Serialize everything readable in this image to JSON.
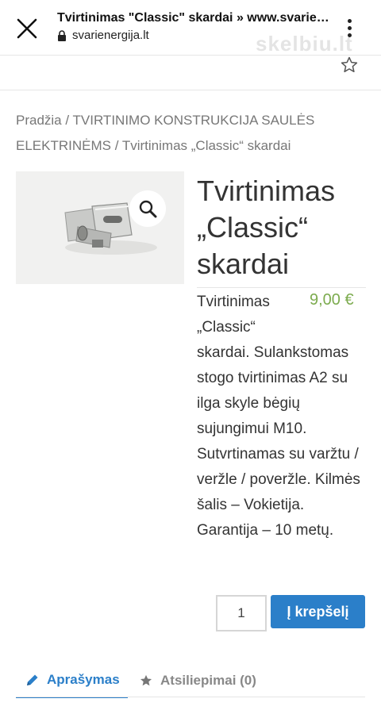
{
  "browser": {
    "page_title": "Tvirtinimas \"Classic\" skardai » www.svarie…",
    "domain": "svarienergija.lt",
    "watermark": "skelbiu.lt"
  },
  "breadcrumb": {
    "home": "Pradžia",
    "sep1": " / ",
    "category": "TVIRTINIMO KONSTRUKCIJA SAULĖS ELEKTRINĖMS",
    "sep2": " / ",
    "current": "Tvirtinimas „Classic“ skardai"
  },
  "product": {
    "title": "Tvirtinimas „Classic“ skardai",
    "price": "9,00 €",
    "description_first": "Tvirtinimas „Classic“",
    "description_rest": "skardai. Sulankstomas stogo tvirtinimas A2 su ilga skyle bėgių sujungimui M10. Sutvrtinamas su varžtu / veržle / poveržle. Kilmės šalis – Vokietija. Garantija – 10 metų."
  },
  "cart": {
    "quantity": "1",
    "button_label": "Į krepšelį"
  },
  "tabs": [
    {
      "label": "Aprašymas",
      "active": true
    },
    {
      "label": "Atsiliepimai (0)",
      "active": false
    }
  ],
  "colors": {
    "accent": "#2b7fc9",
    "price": "#7cab4e"
  },
  "icons": {
    "close": "close-icon",
    "menu": "more-vert-icon",
    "lock": "lock-icon",
    "bookmark": "star-outline-icon",
    "zoom": "magnifier-icon",
    "tab_description": "pencil-icon",
    "tab_reviews": "star-icon"
  }
}
